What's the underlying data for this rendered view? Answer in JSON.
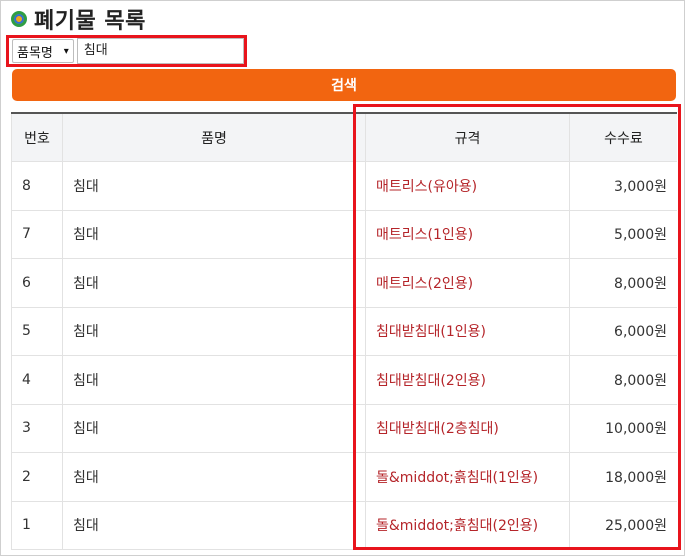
{
  "page": {
    "title": "폐기물 목록"
  },
  "search": {
    "select_value": "품목명",
    "input_value": "침대",
    "button_label": "검색"
  },
  "table": {
    "headers": {
      "no": "번호",
      "name": "품명",
      "spec": "규격",
      "fee": "수수료"
    },
    "rows": [
      {
        "no": "8",
        "name": "침대",
        "spec": "매트리스(유아용)",
        "fee": "3,000원"
      },
      {
        "no": "7",
        "name": "침대",
        "spec": "매트리스(1인용)",
        "fee": "5,000원"
      },
      {
        "no": "6",
        "name": "침대",
        "spec": "매트리스(2인용)",
        "fee": "8,000원"
      },
      {
        "no": "5",
        "name": "침대",
        "spec": "침대받침대(1인용)",
        "fee": "6,000원"
      },
      {
        "no": "4",
        "name": "침대",
        "spec": "침대받침대(2인용)",
        "fee": "8,000원"
      },
      {
        "no": "3",
        "name": "침대",
        "spec": "침대받침대(2층침대)",
        "fee": "10,000원"
      },
      {
        "no": "2",
        "name": "침대",
        "spec": "돌&middot;흙침대(1인용)",
        "fee": "18,000원"
      },
      {
        "no": "1",
        "name": "침대",
        "spec": "돌&middot;흙침대(2인용)",
        "fee": "25,000원"
      }
    ]
  },
  "colors": {
    "accent": "#f26510",
    "highlight": "#e8141c",
    "spec_text": "#b5252a"
  }
}
